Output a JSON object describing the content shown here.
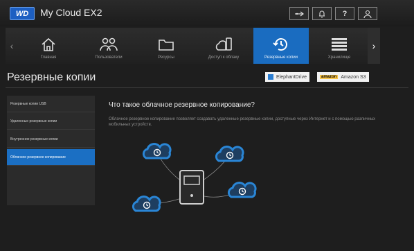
{
  "header": {
    "logo": "WD",
    "product": "My Cloud EX2",
    "icons": [
      "usb-icon",
      "bell-icon",
      "help-icon",
      "user-icon"
    ],
    "help_label": "?"
  },
  "nav": {
    "items": [
      {
        "label": "Главная",
        "icon": "home-icon"
      },
      {
        "label": "Пользователи",
        "icon": "users-icon"
      },
      {
        "label": "Ресурсы",
        "icon": "folder-icon"
      },
      {
        "label": "Доступ к облаку",
        "icon": "cloud-device-icon"
      },
      {
        "label": "Резервные копии",
        "icon": "backup-clock-icon"
      },
      {
        "label": "Хранилище",
        "icon": "storage-icon"
      }
    ],
    "active": "Резервные копии"
  },
  "page": {
    "title": "Резервные копии",
    "services": [
      {
        "label": "ElephantDrive"
      },
      {
        "badge": "amazon",
        "label": "Amazon S3"
      }
    ]
  },
  "sidebar": {
    "items": [
      {
        "label": "Резервные копии USB"
      },
      {
        "label": "Удаленные резервные копии"
      },
      {
        "label": "Внутренние резервные копии"
      },
      {
        "label": "Облачное резервное копирование"
      }
    ],
    "active": "Облачное резервное копирование"
  },
  "content": {
    "question": "Что такое облачное резервное копирование?",
    "description": "Облачное резервное копирование позволяет создавать удаленные резервные копии, доступные через Интернет и с помощью различных мобильных устройств."
  },
  "colors": {
    "accent": "#1a6cc0",
    "cloud": "#2a86d6",
    "background": "#1e1e1e"
  }
}
